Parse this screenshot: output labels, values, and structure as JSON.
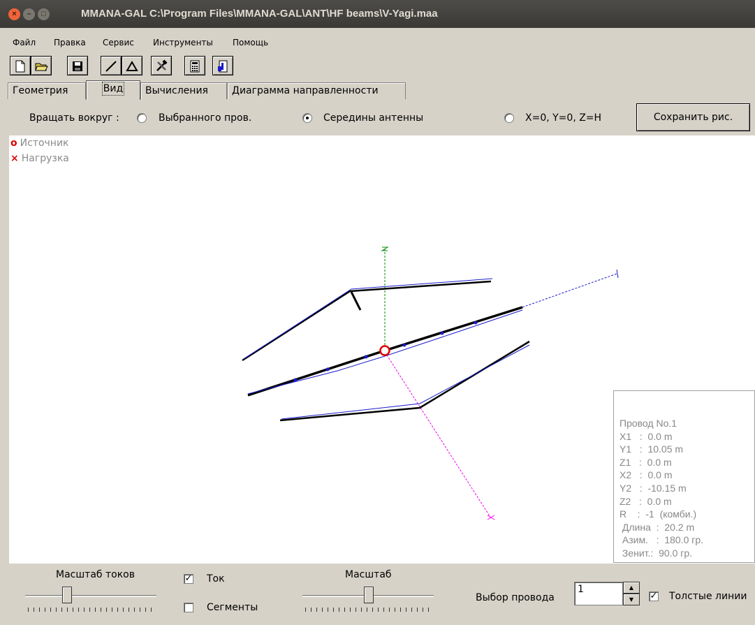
{
  "window": {
    "title": "MMANA-GAL C:\\Program Files\\MMANA-GAL\\ANT\\HF beams\\V-Yagi.maa"
  },
  "menu": {
    "items": [
      "Файл",
      "Правка",
      "Сервис",
      "Инструменты",
      "Помощь"
    ]
  },
  "toolbar": {
    "icons": [
      "new-file-icon",
      "open-folder-icon",
      "save-disk-icon",
      "draw-line-icon",
      "triangle-icon",
      "tools-icon",
      "calculator-icon",
      "exit-door-icon"
    ]
  },
  "tabs": [
    {
      "label": "Геометрия",
      "active": false
    },
    {
      "label": "Вид",
      "active": true
    },
    {
      "label": "Вычисления",
      "active": false
    },
    {
      "label": "Диаграмма направленности",
      "active": false
    }
  ],
  "rotate": {
    "label": "Вращать вокруг :",
    "options": [
      {
        "label": "Выбранного пров.",
        "selected": false
      },
      {
        "label": "Середины антенны",
        "selected": true
      },
      {
        "label": "X=0, Y=0, Z=H",
        "selected": false
      }
    ],
    "save_label": "Сохранить рис."
  },
  "legend": {
    "source": "Источник",
    "load": "Нагрузка"
  },
  "wire_info": {
    "title": "Провод No.1",
    "lines": [
      "X1   :  0.0 m",
      "Y1   :  10.05 m",
      "Z1   :  0.0 m",
      "X2   :  0.0 m",
      "Y2   :  -10.15 m",
      "Z2   :  0.0 m",
      "R    :  -1  (комби.)",
      " Длина  :  20.2 m",
      " Азим.   :  180.0 гр.",
      " Зенит.:  90.0 гр."
    ]
  },
  "controls": {
    "current_scale_label": "Масштаб токов",
    "current_label": "Ток",
    "current_checked": true,
    "segments_label": "Сегменты",
    "segments_checked": false,
    "scale_label": "Масштаб",
    "wire_select_label": "Выбор провода",
    "wire_select_value": "1",
    "thick_lines_label": "Толстые линии",
    "thick_lines_checked": true
  },
  "colors": {
    "wire_current": "#1a1acc",
    "source": "#e00000",
    "axis_x": "#ee00ee",
    "axis_y": "#1a1acc",
    "axis_z": "#008800"
  }
}
